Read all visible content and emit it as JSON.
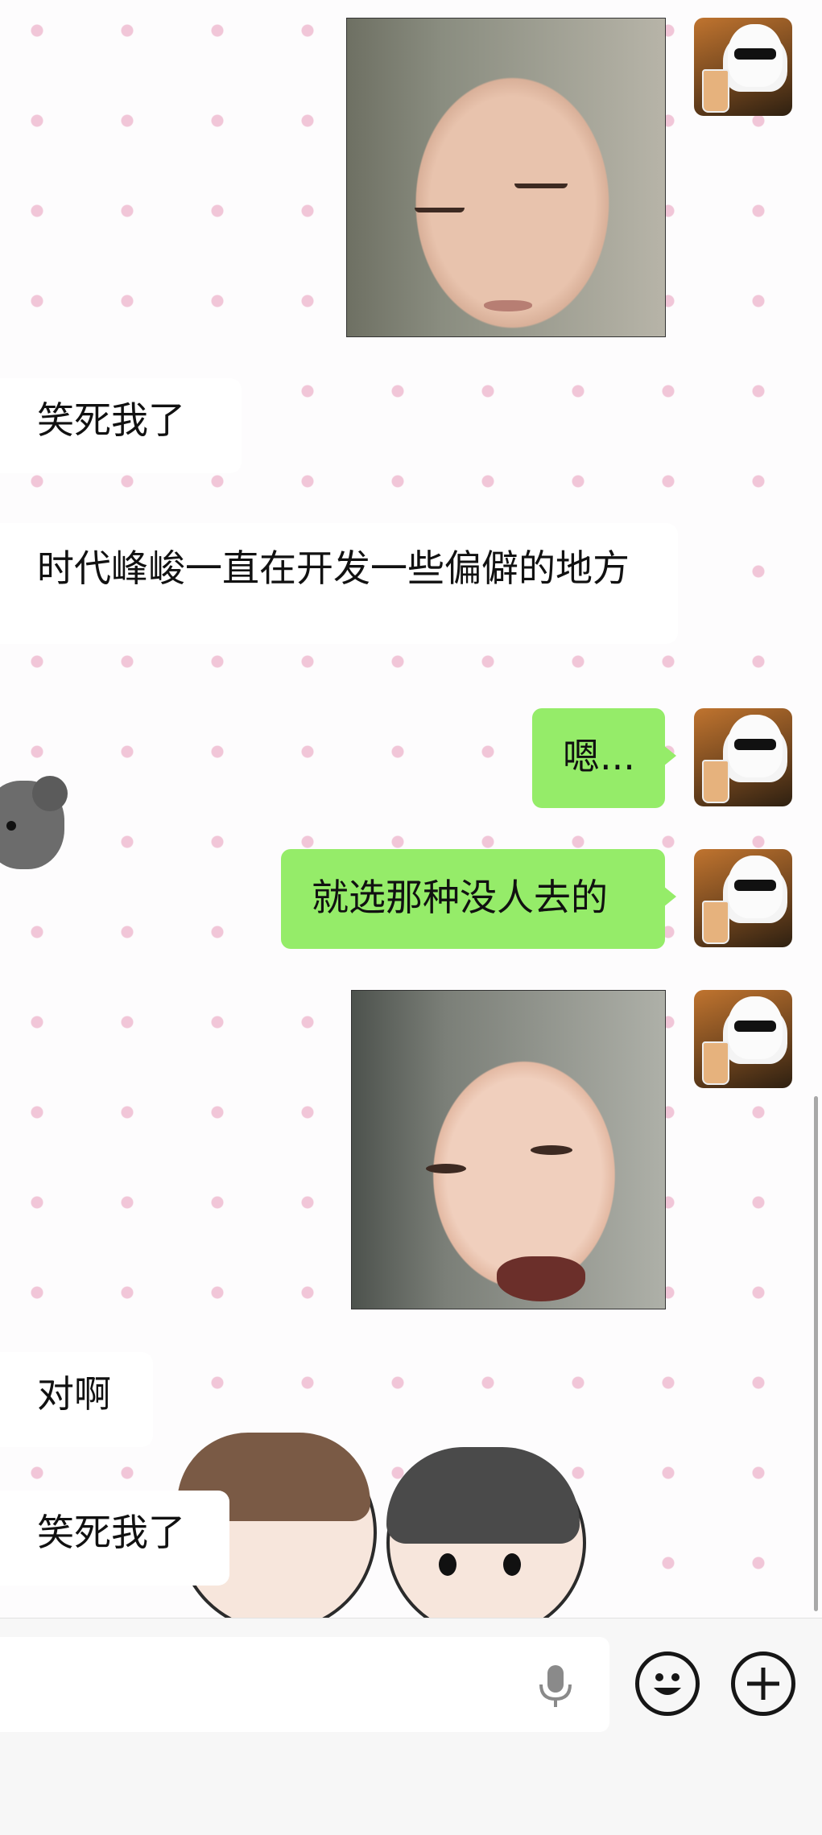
{
  "messages": [
    {
      "side": "right",
      "type": "image",
      "content": "baby-sleeping-face"
    },
    {
      "side": "left",
      "type": "text",
      "text": "笑死我了"
    },
    {
      "side": "left",
      "type": "text",
      "text": "时代峰峻一直在开发一些偏僻的地方"
    },
    {
      "side": "right",
      "type": "text",
      "text": "嗯..."
    },
    {
      "side": "right",
      "type": "text",
      "text": "就选那种没人去的"
    },
    {
      "side": "right",
      "type": "image",
      "content": "baby-crying-face"
    },
    {
      "side": "left",
      "type": "text",
      "text": "对啊"
    },
    {
      "side": "left",
      "type": "text",
      "text": "笑死我了"
    }
  ],
  "text": {
    "m1": "笑死我了",
    "m2": "时代峰峻一直在开发一些偏僻的地方",
    "m3": "嗯...",
    "m4": "就选那种没人去的",
    "m5": "对啊",
    "m6": "笑死我了"
  },
  "input": {
    "value": "",
    "placeholder": ""
  },
  "icons": {
    "voice": "microphone-icon",
    "emoji": "smiley-icon",
    "more": "plus-icon"
  },
  "colors": {
    "sent_bubble": "#95ec69",
    "received_bubble": "#ffffff",
    "wallpaper_dot": "#f1c6d8"
  }
}
